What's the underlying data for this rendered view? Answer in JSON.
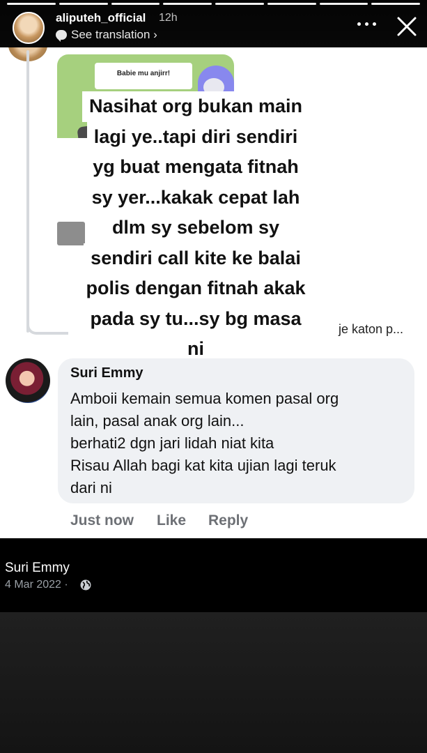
{
  "story": {
    "username": "aliputeh_official",
    "time": "12h",
    "see_translation": "See translation ›",
    "progress_segments": 8,
    "active_segment": 7
  },
  "meme": {
    "caption": "Babie mu anjirr!"
  },
  "overlay": {
    "lines": [
      "Nasihat org bukan main",
      "lagi ye..tapi diri sendiri",
      "yg buat mengata fitnah",
      "sy yer...kakak cepat lah",
      "dlm sy sebelom sy",
      "sendiri call kite ke balai",
      "polis dengan fitnah akak",
      "pada sy tu...sy bg masa",
      "ni"
    ]
  },
  "reply_snippet": "je katon p...",
  "comment": {
    "author": "Suri Emmy",
    "lines": [
      "Amboii kemain semua komen pasal org",
      "lain, pasal anak org lain...",
      "berhati2 dgn jari lidah niat kita",
      "Risau Allah bagi kat kita ujian lagi teruk",
      "dari ni"
    ],
    "time": "Just now",
    "like_label": "Like",
    "reply_label": "Reply"
  },
  "post": {
    "author": "Suri Emmy",
    "date": "4 Mar 2022 ·"
  },
  "icons": {
    "translate": "speech-bubble-icon",
    "more": "more-dots-icon",
    "close": "close-icon",
    "globe": "globe-icon"
  }
}
